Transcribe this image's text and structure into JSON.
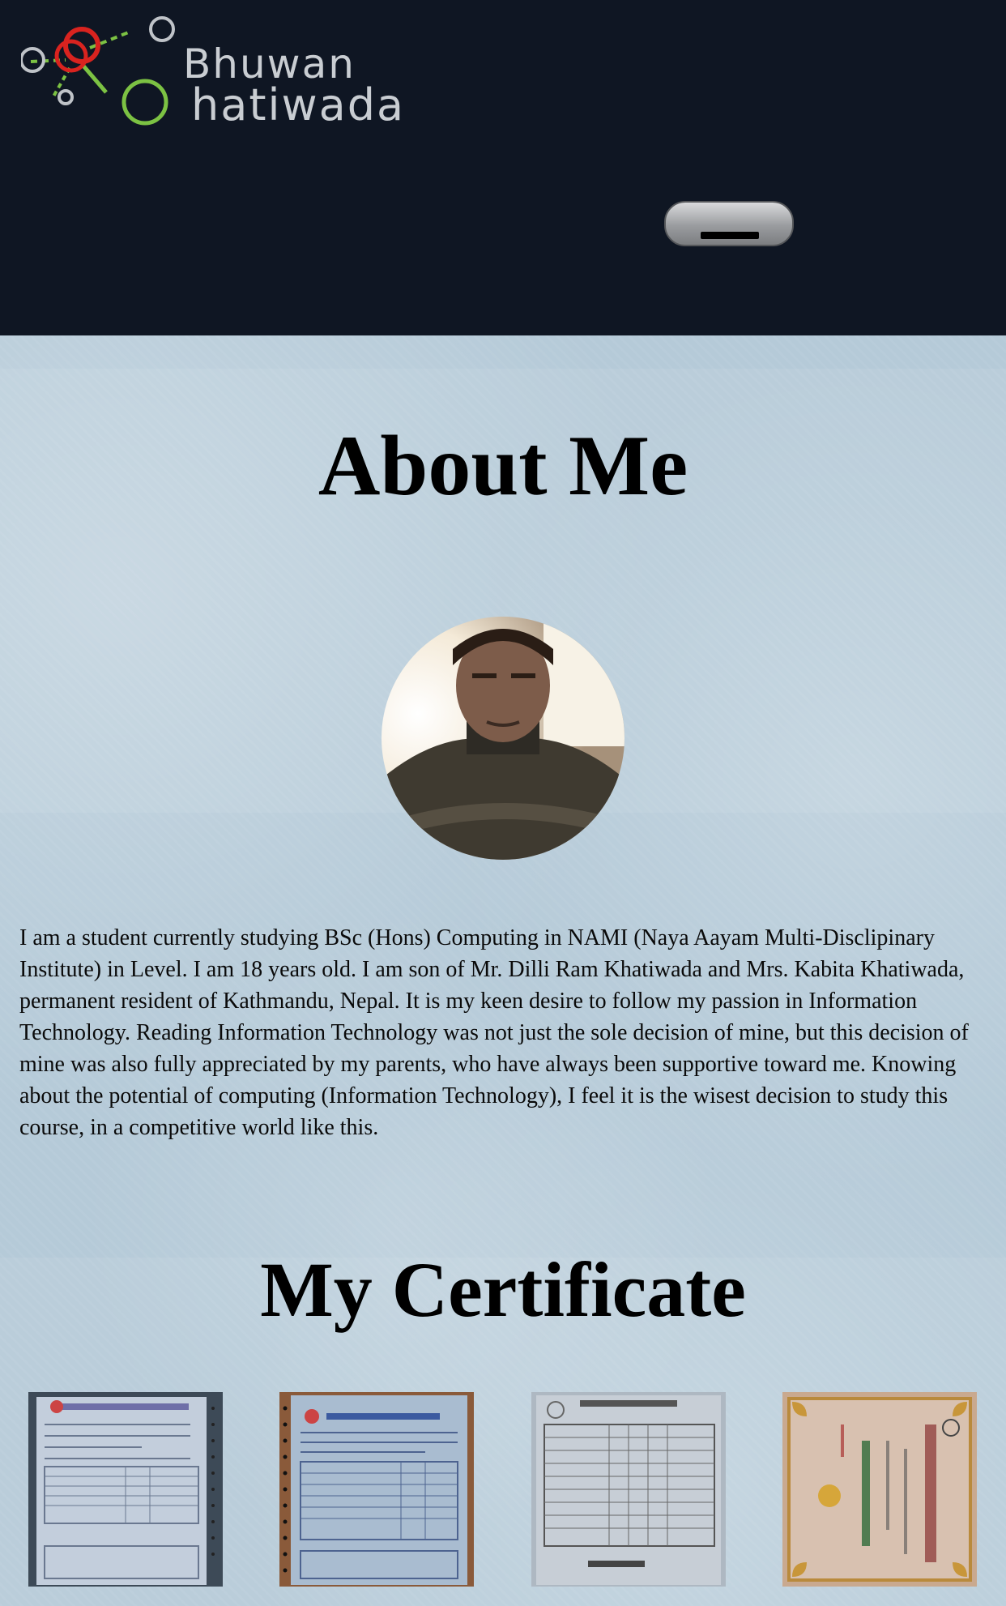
{
  "header": {
    "logo_first": "Bhuwan",
    "logo_last": "hatiwada"
  },
  "about": {
    "title": "About Me",
    "bio": "I am a student currently studying BSc (Hons) Computing in NAMI (Naya Aayam Multi-Disclipinary Institute) in Level. I am 18 years old. I am son of Mr. Dilli Ram Khatiwada and Mrs. Kabita Khatiwada, permanent resident of Kathmandu, Nepal. It is my keen desire to follow my passion in Information Technology. Reading Information Technology was not just the sole decision of mine, but this decision of mine was also fully appreciated by my parents, who have always been supportive toward me. Knowing about the potential of computing (Information Technology), I feel it is the wisest decision to study this course, in a competitive world like this."
  },
  "certificates": {
    "title": "My Certificate"
  },
  "colors": {
    "header_bg": "#0f1623",
    "page_bg": "#b5cad8",
    "logo_red": "#d9231f",
    "logo_green": "#7cc243"
  }
}
